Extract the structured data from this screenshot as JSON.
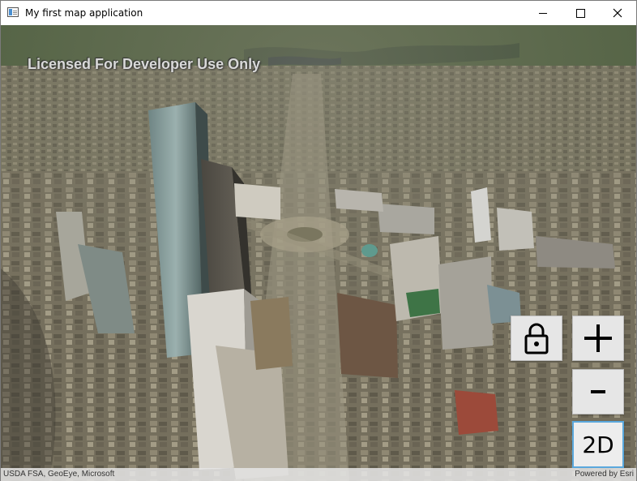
{
  "window": {
    "title": "My first map application"
  },
  "map": {
    "watermark": "Licensed For Developer Use Only",
    "attribution": "USDA FSA, GeoEye, Microsoft",
    "powered_by": "Powered by Esri"
  },
  "controls": {
    "lock_icon": "lock-icon",
    "zoom_in_icon": "plus-icon",
    "zoom_out_icon": "minus-icon",
    "mode_label": "2D"
  }
}
